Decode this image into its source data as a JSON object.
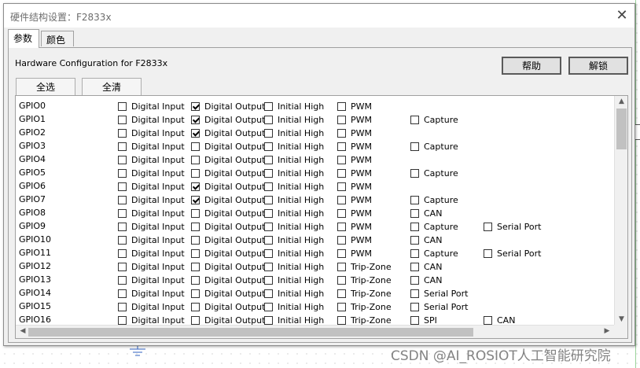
{
  "window": {
    "title": "硬件结构设置：F2833x",
    "close_glyph": "✕"
  },
  "tabs": [
    {
      "label": "参数",
      "active": true
    },
    {
      "label": "颜色",
      "active": false
    }
  ],
  "panel": {
    "hw_label": "Hardware Configuration for F2833x",
    "help_label": "帮助",
    "unlock_label": "解锁",
    "select_all_label": "全选",
    "clear_all_label": "全清"
  },
  "rows": [
    {
      "name": "GPIO0",
      "opts": [
        {
          "label": "Digital Input",
          "checked": false
        },
        {
          "label": "Digital Output",
          "checked": true
        },
        {
          "label": "Initial High",
          "checked": false
        },
        {
          "label": "PWM",
          "checked": false
        }
      ]
    },
    {
      "name": "GPIO1",
      "opts": [
        {
          "label": "Digital Input",
          "checked": false
        },
        {
          "label": "Digital Output",
          "checked": true
        },
        {
          "label": "Initial High",
          "checked": false
        },
        {
          "label": "PWM",
          "checked": false
        },
        {
          "label": "Capture",
          "checked": false
        }
      ]
    },
    {
      "name": "GPIO2",
      "opts": [
        {
          "label": "Digital Input",
          "checked": false
        },
        {
          "label": "Digital Output",
          "checked": true
        },
        {
          "label": "Initial High",
          "checked": false
        },
        {
          "label": "PWM",
          "checked": false
        }
      ]
    },
    {
      "name": "GPIO3",
      "opts": [
        {
          "label": "Digital Input",
          "checked": false
        },
        {
          "label": "Digital Output",
          "checked": false
        },
        {
          "label": "Initial High",
          "checked": false
        },
        {
          "label": "PWM",
          "checked": false
        },
        {
          "label": "Capture",
          "checked": false
        }
      ]
    },
    {
      "name": "GPIO4",
      "opts": [
        {
          "label": "Digital Input",
          "checked": false
        },
        {
          "label": "Digital Output",
          "checked": false
        },
        {
          "label": "Initial High",
          "checked": false
        },
        {
          "label": "PWM",
          "checked": false
        }
      ]
    },
    {
      "name": "GPIO5",
      "opts": [
        {
          "label": "Digital Input",
          "checked": false
        },
        {
          "label": "Digital Output",
          "checked": false
        },
        {
          "label": "Initial High",
          "checked": false
        },
        {
          "label": "PWM",
          "checked": false
        },
        {
          "label": "Capture",
          "checked": false
        }
      ]
    },
    {
      "name": "GPIO6",
      "opts": [
        {
          "label": "Digital Input",
          "checked": false
        },
        {
          "label": "Digital Output",
          "checked": true
        },
        {
          "label": "Initial High",
          "checked": false
        },
        {
          "label": "PWM",
          "checked": false
        }
      ]
    },
    {
      "name": "GPIO7",
      "opts": [
        {
          "label": "Digital Input",
          "checked": false
        },
        {
          "label": "Digital Output",
          "checked": true
        },
        {
          "label": "Initial High",
          "checked": false
        },
        {
          "label": "PWM",
          "checked": false
        },
        {
          "label": "Capture",
          "checked": false
        }
      ]
    },
    {
      "name": "GPIO8",
      "opts": [
        {
          "label": "Digital Input",
          "checked": false
        },
        {
          "label": "Digital Output",
          "checked": false
        },
        {
          "label": "Initial High",
          "checked": false
        },
        {
          "label": "PWM",
          "checked": false
        },
        {
          "label": "CAN",
          "checked": false
        }
      ]
    },
    {
      "name": "GPIO9",
      "opts": [
        {
          "label": "Digital Input",
          "checked": false
        },
        {
          "label": "Digital Output",
          "checked": false
        },
        {
          "label": "Initial High",
          "checked": false
        },
        {
          "label": "PWM",
          "checked": false
        },
        {
          "label": "Capture",
          "checked": false
        },
        {
          "label": "Serial Port",
          "checked": false
        }
      ]
    },
    {
      "name": "GPIO10",
      "opts": [
        {
          "label": "Digital Input",
          "checked": false
        },
        {
          "label": "Digital Output",
          "checked": false
        },
        {
          "label": "Initial High",
          "checked": false
        },
        {
          "label": "PWM",
          "checked": false
        },
        {
          "label": "CAN",
          "checked": false
        }
      ]
    },
    {
      "name": "GPIO11",
      "opts": [
        {
          "label": "Digital Input",
          "checked": false
        },
        {
          "label": "Digital Output",
          "checked": false
        },
        {
          "label": "Initial High",
          "checked": false
        },
        {
          "label": "PWM",
          "checked": false
        },
        {
          "label": "Capture",
          "checked": false
        },
        {
          "label": "Serial Port",
          "checked": false
        }
      ]
    },
    {
      "name": "GPIO12",
      "opts": [
        {
          "label": "Digital Input",
          "checked": false
        },
        {
          "label": "Digital Output",
          "checked": false
        },
        {
          "label": "Initial High",
          "checked": false
        },
        {
          "label": "Trip-Zone",
          "checked": false
        },
        {
          "label": "CAN",
          "checked": false
        }
      ]
    },
    {
      "name": "GPIO13",
      "opts": [
        {
          "label": "Digital Input",
          "checked": false
        },
        {
          "label": "Digital Output",
          "checked": false
        },
        {
          "label": "Initial High",
          "checked": false
        },
        {
          "label": "Trip-Zone",
          "checked": false
        },
        {
          "label": "CAN",
          "checked": false
        }
      ]
    },
    {
      "name": "GPIO14",
      "opts": [
        {
          "label": "Digital Input",
          "checked": false
        },
        {
          "label": "Digital Output",
          "checked": false
        },
        {
          "label": "Initial High",
          "checked": false
        },
        {
          "label": "Trip-Zone",
          "checked": false
        },
        {
          "label": "Serial Port",
          "checked": false
        }
      ]
    },
    {
      "name": "GPIO15",
      "opts": [
        {
          "label": "Digital Input",
          "checked": false
        },
        {
          "label": "Digital Output",
          "checked": false
        },
        {
          "label": "Initial High",
          "checked": false
        },
        {
          "label": "Trip-Zone",
          "checked": false
        },
        {
          "label": "Serial Port",
          "checked": false
        }
      ]
    },
    {
      "name": "GPIO16",
      "opts": [
        {
          "label": "Digital Input",
          "checked": false
        },
        {
          "label": "Digital Output",
          "checked": false
        },
        {
          "label": "Initial High",
          "checked": false
        },
        {
          "label": "Trip-Zone",
          "checked": false
        },
        {
          "label": "SPI",
          "checked": false
        },
        {
          "label": "CAN",
          "checked": false
        }
      ]
    }
  ],
  "scroll": {
    "up": "▲",
    "down": "▼",
    "left": "◀",
    "right": "▶"
  },
  "watermark": "CSDN @AI_ROSIOT人工智能研究院"
}
